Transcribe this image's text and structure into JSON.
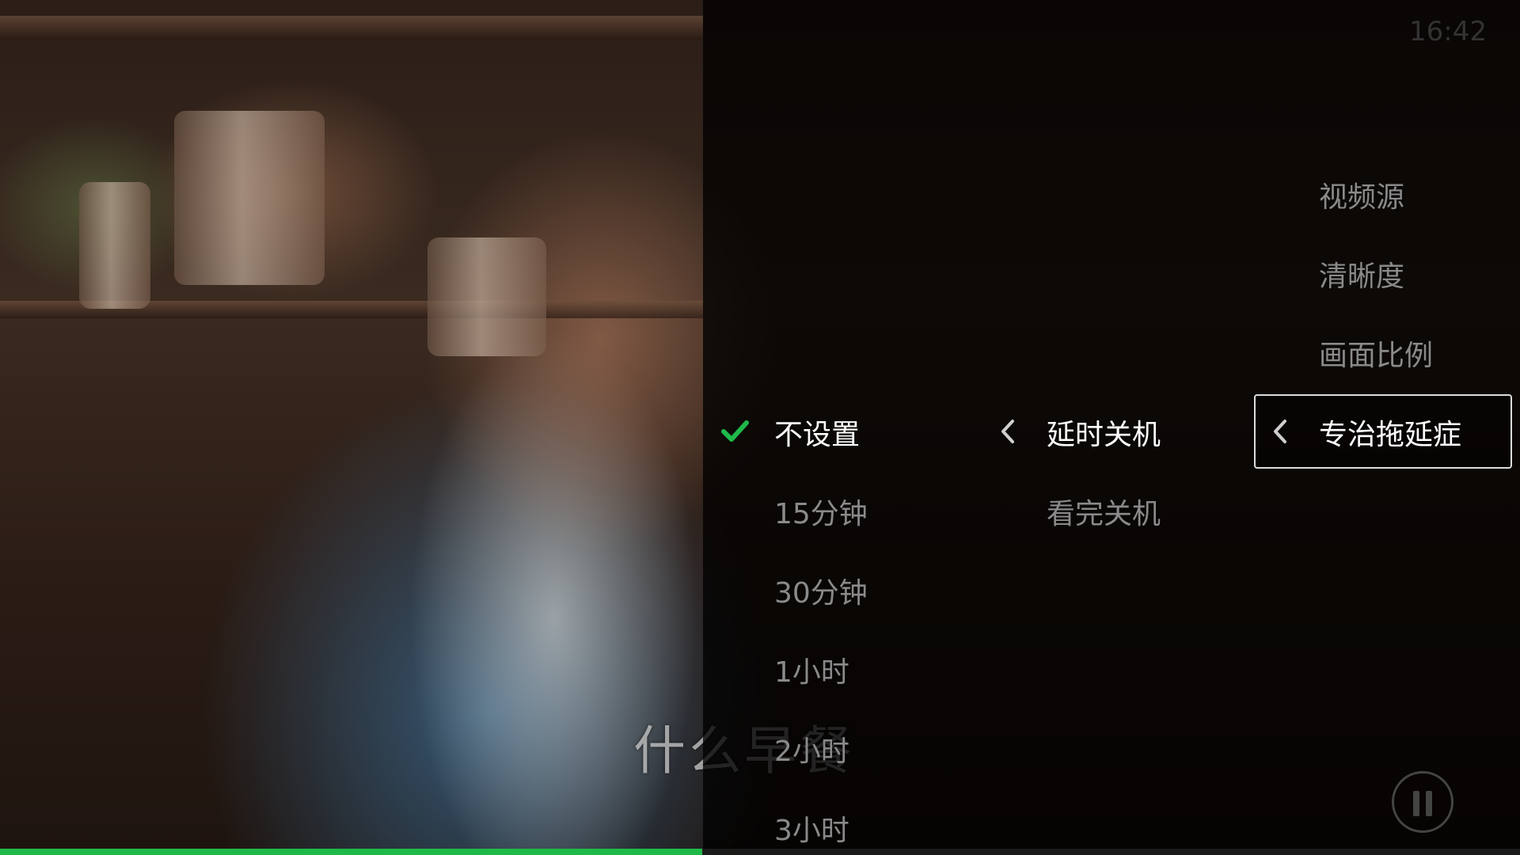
{
  "clock": "16:42",
  "subtitle": "什么早餐",
  "sleep_options": {
    "items": [
      {
        "label": "不设置",
        "selected": true
      },
      {
        "label": "15分钟",
        "selected": false
      },
      {
        "label": "30分钟",
        "selected": false
      },
      {
        "label": "1小时",
        "selected": false
      },
      {
        "label": "2小时",
        "selected": false
      },
      {
        "label": "3小时",
        "selected": false
      }
    ]
  },
  "shutdown_menu": {
    "items": [
      {
        "label": "延时关机",
        "active": true
      },
      {
        "label": "看完关机",
        "active": false
      }
    ]
  },
  "main_menu": {
    "items": [
      {
        "label": "视频源",
        "active": false
      },
      {
        "label": "清晰度",
        "active": false
      },
      {
        "label": "画面比例",
        "active": false
      },
      {
        "label": "专治拖延症",
        "active": true
      }
    ]
  },
  "progress": {
    "fraction": 0.462
  },
  "colors": {
    "accent_green": "#1fb94a",
    "text_active": "#ffffff",
    "text_inactive": "#8a8a8a",
    "overlay": "#000000"
  },
  "icons": {
    "check": "check-icon",
    "chevron": "chevron-left-icon",
    "pause": "pause-icon"
  }
}
